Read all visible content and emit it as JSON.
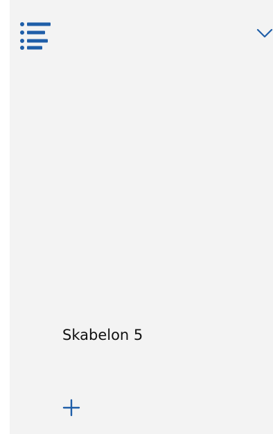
{
  "colors": {
    "accent": "#1f5ea8",
    "panel_background": "#f3f3f3",
    "text": "#111111"
  },
  "header": {
    "menu_icon": "list-icon",
    "dropdown_icon": "chevron-down-icon"
  },
  "template": {
    "label": "Skabelon 5"
  },
  "footer": {
    "add_icon": "plus-icon"
  }
}
